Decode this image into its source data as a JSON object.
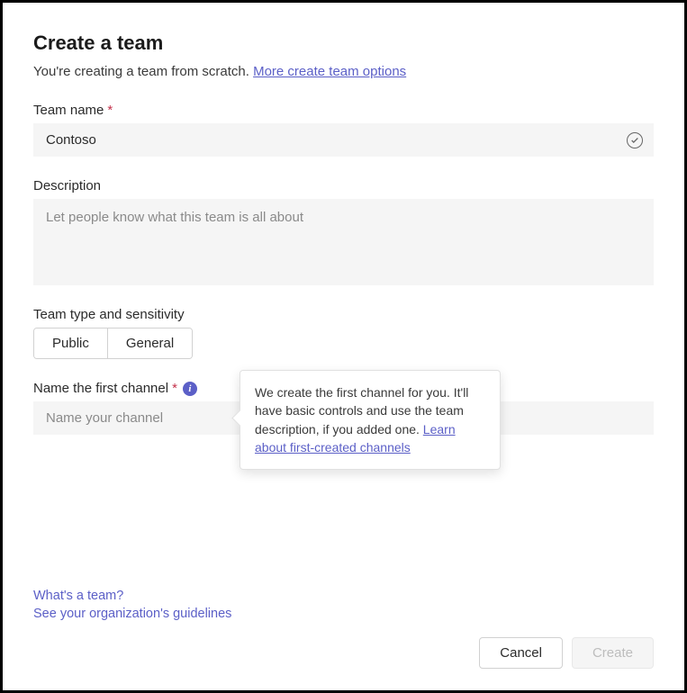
{
  "title": "Create a team",
  "subtitle": {
    "text": "You're creating a team from scratch. ",
    "link": "More create team options"
  },
  "fields": {
    "team_name": {
      "label": "Team name",
      "value": "Contoso"
    },
    "description": {
      "label": "Description",
      "placeholder": "Let people know what this team is all about"
    },
    "team_type": {
      "label": "Team type and sensitivity",
      "options": [
        "Public",
        "General"
      ]
    },
    "first_channel": {
      "label": "Name the first channel",
      "placeholder": "Name your channel"
    }
  },
  "tooltip": {
    "text": "We create the first channel for you. It'll have basic controls and use the team description, if you added one. ",
    "link": "Learn about first-created channels"
  },
  "footer": {
    "whats_a_team": "What's a team?",
    "guidelines": "See your organization's guidelines"
  },
  "buttons": {
    "cancel": "Cancel",
    "create": "Create"
  }
}
